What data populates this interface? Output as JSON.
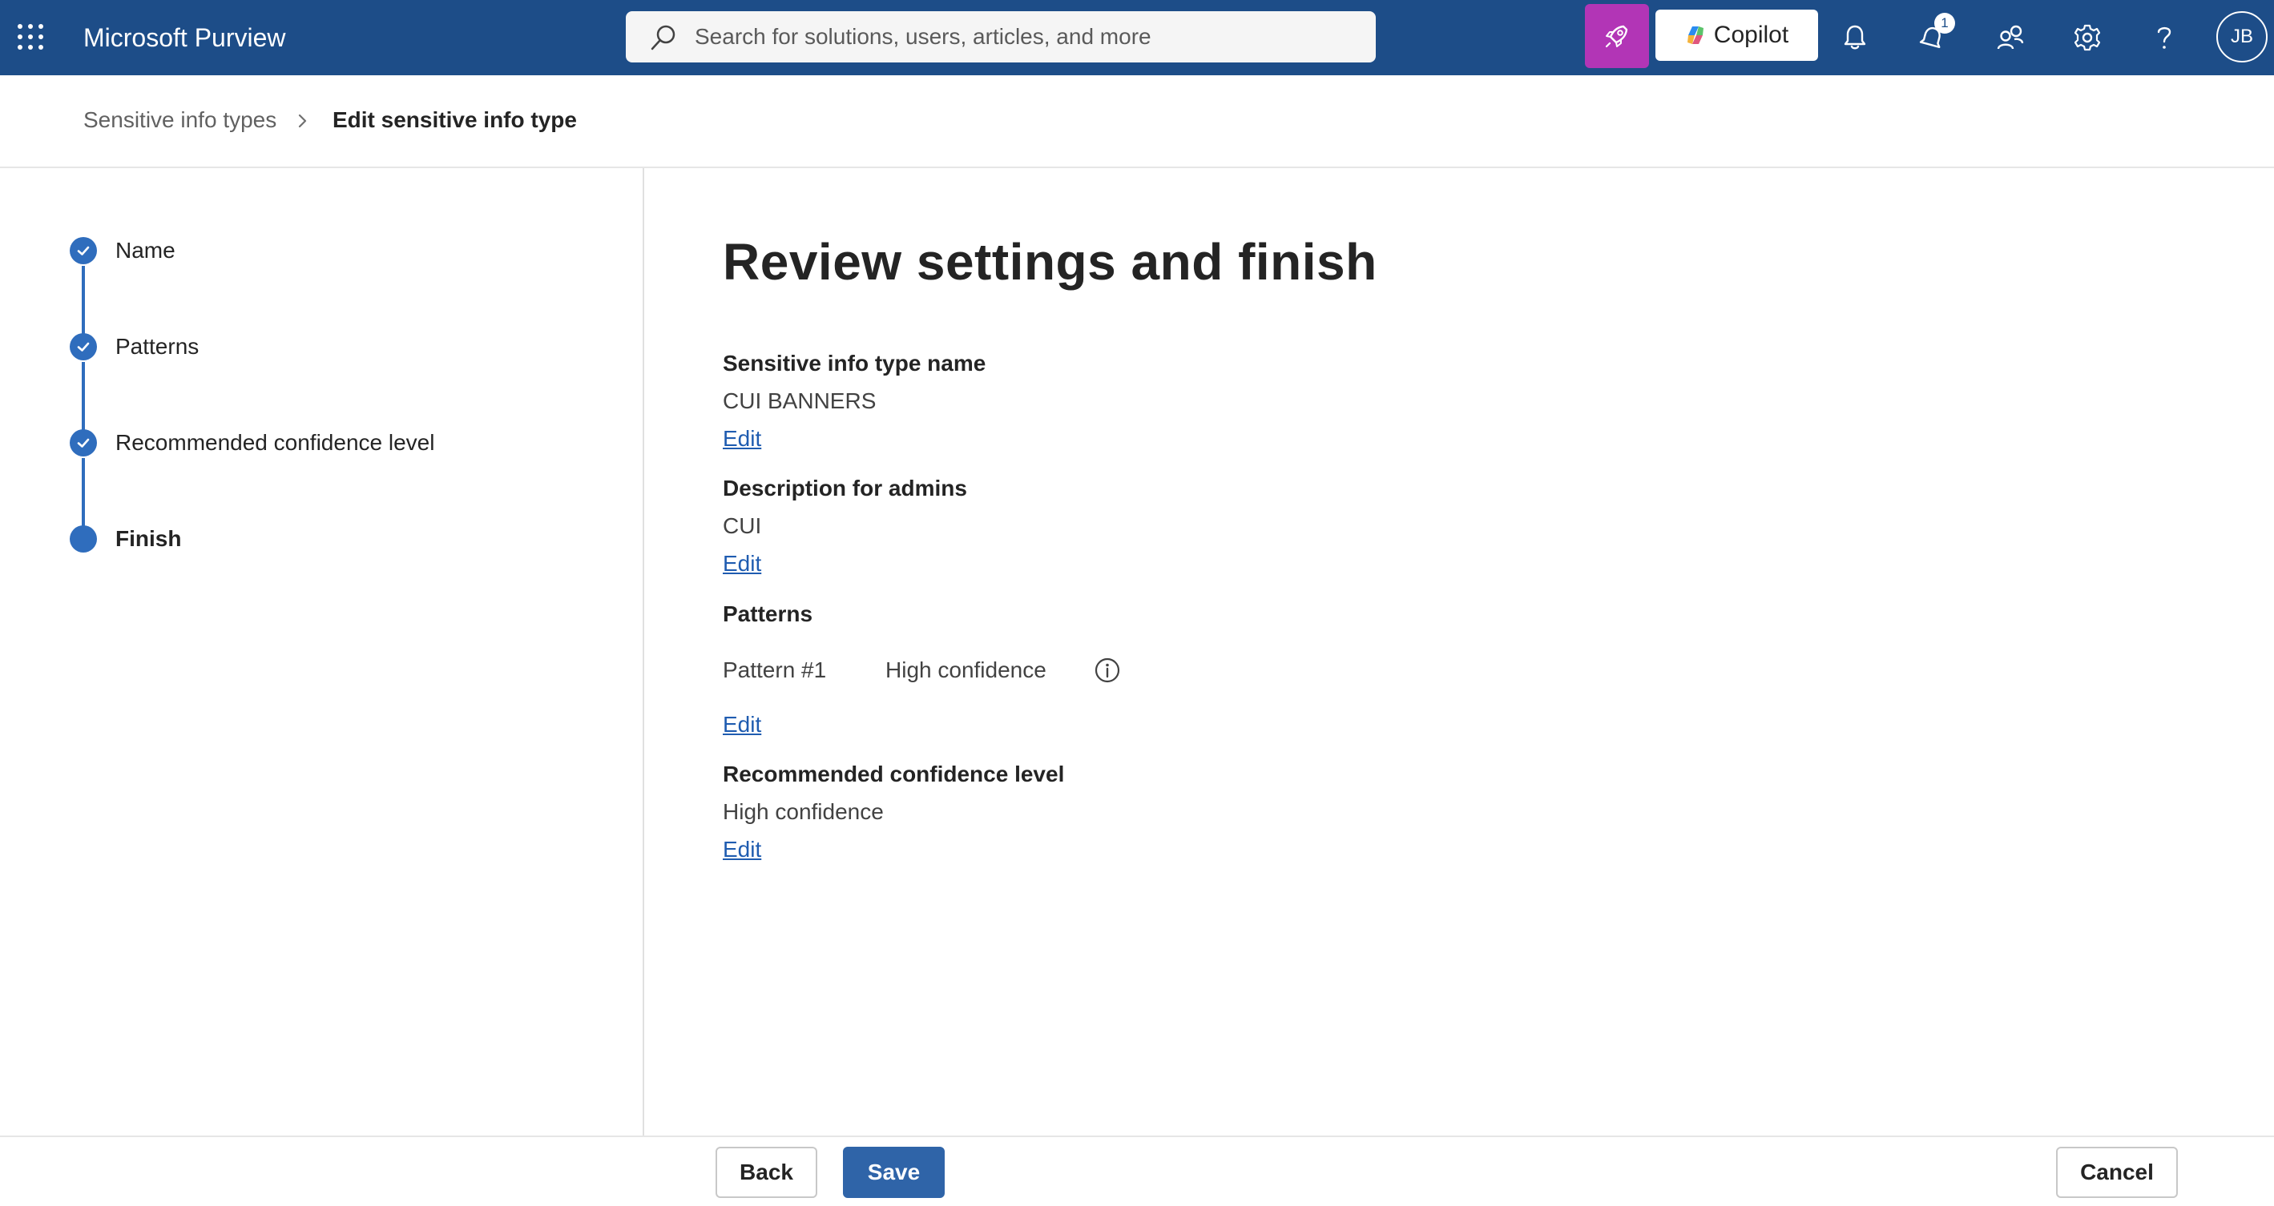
{
  "topbar": {
    "app_title": "Microsoft Purview",
    "search_placeholder": "Search for solutions, users, articles, and more",
    "copilot_label": "Copilot",
    "notification_count": "1",
    "avatar_initials": "JB",
    "icons": [
      "app-launcher-icon",
      "search-icon",
      "rocket-icon",
      "copilot-icon",
      "bell-icon",
      "alert-bell-icon",
      "people-icon",
      "gear-icon",
      "help-icon"
    ],
    "colors": {
      "bar": "#1d4d88",
      "rocket": "#b235b6"
    }
  },
  "breadcrumb": {
    "parent": "Sensitive info types",
    "current": "Edit sensitive info type"
  },
  "steps": [
    {
      "label": "Name",
      "status": "completed"
    },
    {
      "label": "Patterns",
      "status": "completed"
    },
    {
      "label": "Recommended confidence level",
      "status": "completed"
    },
    {
      "label": "Finish",
      "status": "current"
    }
  ],
  "main": {
    "title": "Review settings and finish",
    "sections": {
      "name": {
        "heading": "Sensitive info type name",
        "value": "CUI BANNERS",
        "edit": "Edit"
      },
      "description": {
        "heading": "Description for admins",
        "value": "CUI",
        "edit": "Edit"
      },
      "patterns": {
        "heading": "Patterns",
        "rows": [
          {
            "pattern": "Pattern #1",
            "confidence": "High confidence"
          }
        ],
        "edit": "Edit"
      },
      "confidence": {
        "heading": "Recommended confidence level",
        "value": "High confidence",
        "edit": "Edit"
      }
    }
  },
  "footer": {
    "back": "Back",
    "save": "Save",
    "cancel": "Cancel"
  }
}
